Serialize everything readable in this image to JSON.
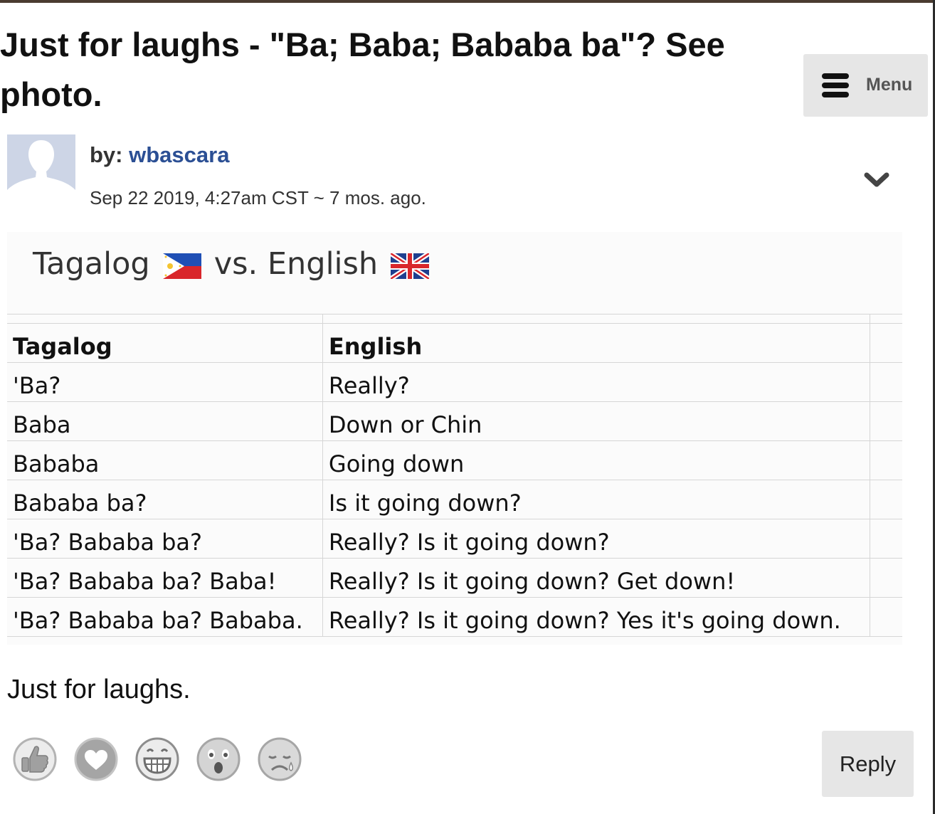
{
  "post": {
    "title": "Just for laughs - \"Ba; Baba; Bababa ba\"? See photo.",
    "by_label": "by:",
    "author": "wbascara",
    "meta": "Sep 22 2019, 4:27am CST ~ 7 mos. ago.",
    "body": "Just for laughs."
  },
  "menu": {
    "label": "Menu",
    "icon": "hamburger-icon"
  },
  "image": {
    "heading_left": "Tagalog",
    "heading_mid": "vs. English",
    "flag_left": "philippines-flag-icon",
    "flag_right": "uk-flag-icon",
    "table": {
      "headers": [
        "Tagalog",
        "English"
      ],
      "rows": [
        [
          "'Ba?",
          "Really?"
        ],
        [
          "Baba",
          "Down or Chin"
        ],
        [
          "Bababa",
          "Going down"
        ],
        [
          "Bababa ba?",
          "Is it going down?"
        ],
        [
          "'Ba? Bababa ba?",
          "Really? Is it going down?"
        ],
        [
          "'Ba? Bababa ba? Baba!",
          "Really? Is it going down? Get down!"
        ],
        [
          "'Ba? Bababa ba? Bababa.",
          "Really? Is it going down? Yes it's going down."
        ]
      ]
    }
  },
  "reactions": [
    "thumbs-up-icon",
    "heart-icon",
    "grin-icon",
    "surprised-icon",
    "sad-icon"
  ],
  "actions": {
    "reply_label": "Reply"
  },
  "colors": {
    "author_link": "#2b4f94",
    "button_bg": "#e6e6e6",
    "avatar_bg": "#cdd5e6"
  }
}
